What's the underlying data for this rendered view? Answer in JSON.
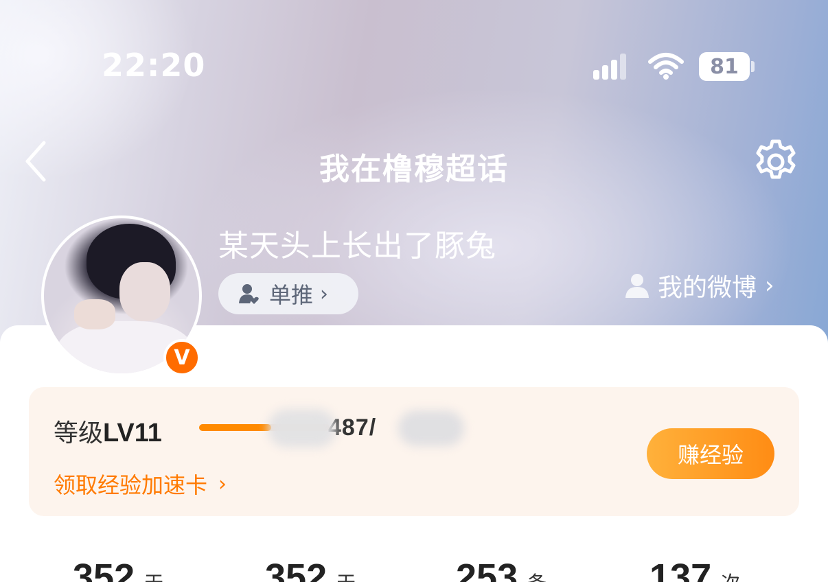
{
  "status_bar": {
    "time": "22:20",
    "battery": "81"
  },
  "nav": {
    "title": "我在橹穆超话",
    "back_icon": "chevron-left-icon",
    "settings_icon": "gear-icon"
  },
  "profile": {
    "username": "某天头上长出了豚兔",
    "verified_badge": "V",
    "tag_label": "单推",
    "tag_chevron": "›",
    "my_weibo_label": "我的微博",
    "my_weibo_chevron": "›"
  },
  "level": {
    "label": "等级",
    "level_value": "LV11",
    "exp_text": "487/",
    "progress_fraction": 0.55,
    "boost_label": "领取经验加速卡",
    "boost_chevron": "›",
    "earn_button": "赚经验"
  },
  "stats": [
    {
      "value": "352",
      "unit": "天"
    },
    {
      "value": "352",
      "unit": "天"
    },
    {
      "value": "253",
      "unit": "条"
    },
    {
      "value": "137",
      "unit": "次"
    }
  ],
  "colors": {
    "accent": "#ff8a00",
    "badge": "#ff6c00"
  }
}
